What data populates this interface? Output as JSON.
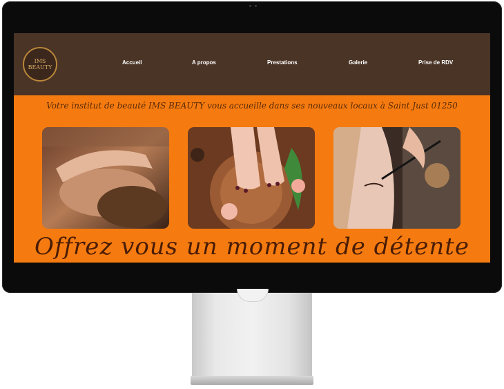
{
  "site": {
    "logo_text": [
      "IMS",
      "BEAUTY"
    ],
    "nav": [
      {
        "label": "Accueil"
      },
      {
        "label": "A propos"
      },
      {
        "label": "Prestations"
      },
      {
        "label": "Galerie"
      },
      {
        "label": "Prise de RDV"
      }
    ],
    "tagline": "Votre institut de beauté IMS BEAUTY vous accueille dans ses nouveaux locaux à Saint Just 01250",
    "headline": "Offrez vous un moment de détente .....",
    "images": [
      {
        "name": "massage-photo"
      },
      {
        "name": "pedicure-photo"
      },
      {
        "name": "makeup-photo"
      }
    ]
  },
  "colors": {
    "header_bg": "#4a3426",
    "page_bg": "#f57b10",
    "text_dark": "#4a1c05",
    "logo_gold": "#b9873a"
  }
}
